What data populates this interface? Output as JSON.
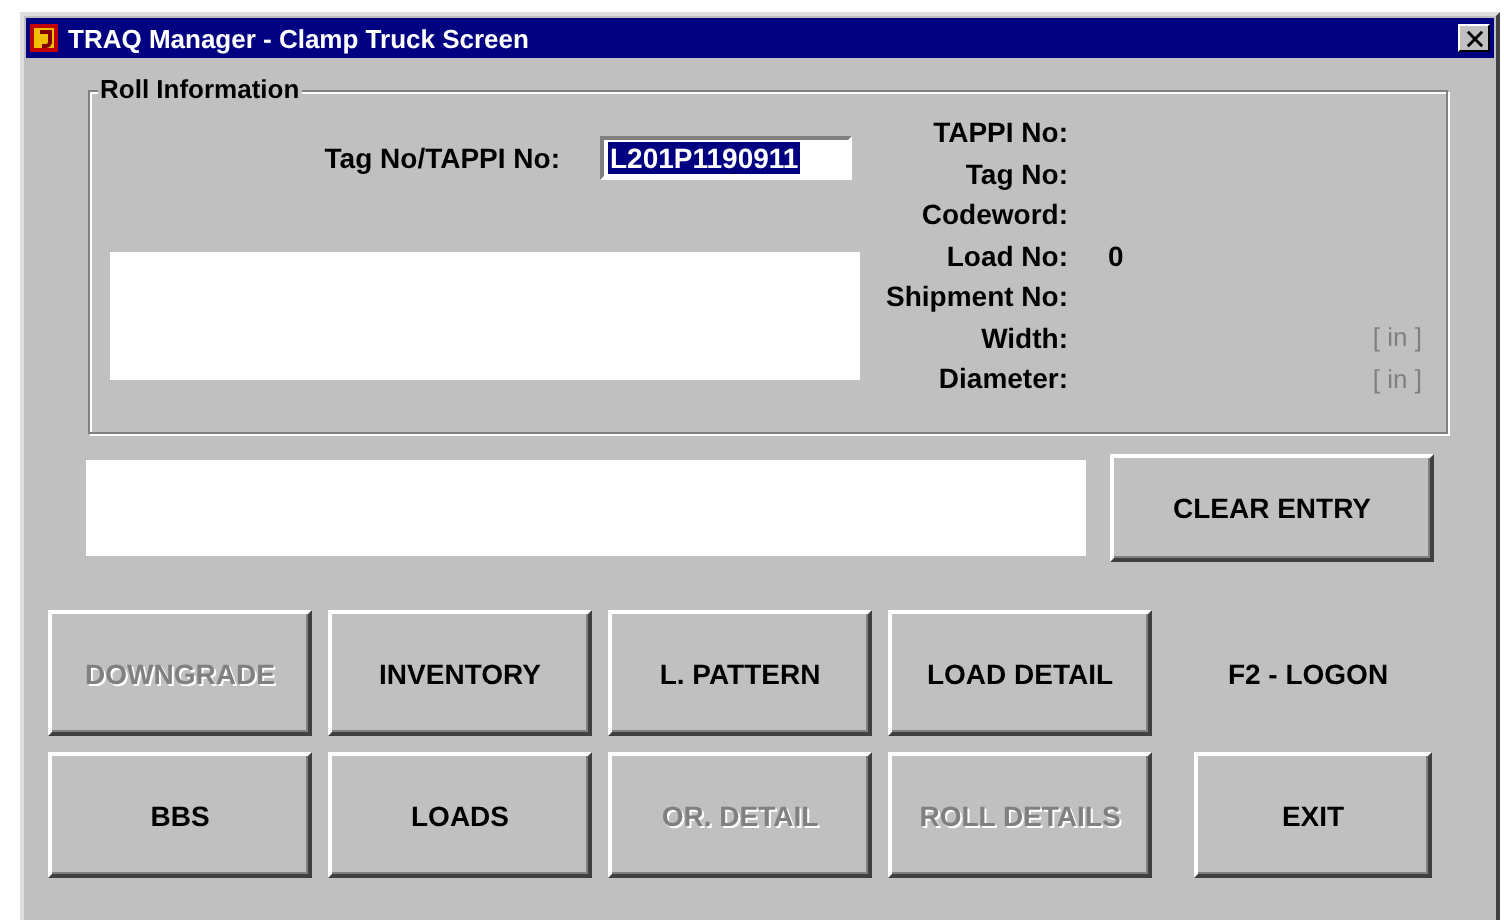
{
  "window": {
    "title": "TRAQ Manager - Clamp Truck Screen"
  },
  "roll_information": {
    "title": "Roll Information",
    "tag_field": {
      "label": "Tag No/TAPPI No:",
      "value": "L201P1190911",
      "selected": true
    },
    "details": [
      {
        "label": "TAPPI No:"
      },
      {
        "label": "Tag No:"
      },
      {
        "label": "Codeword:"
      },
      {
        "label": "Load No:",
        "value": "0"
      },
      {
        "label": "Shipment No:"
      },
      {
        "label": "Width:",
        "unit": "[ in ]"
      },
      {
        "label": "Diameter:",
        "unit": "[ in ]"
      }
    ]
  },
  "clear_entry_button": {
    "label": "CLEAR ENTRY",
    "disabled": false
  },
  "buttons": [
    {
      "kind": "button",
      "label": "DOWNGRADE",
      "disabled": true
    },
    {
      "kind": "button",
      "label": "INVENTORY",
      "disabled": false
    },
    {
      "kind": "button",
      "label": "L. PATTERN",
      "disabled": false
    },
    {
      "kind": "button",
      "label": "LOAD DETAIL",
      "disabled": false
    },
    {
      "kind": "text",
      "label": "F2 - LOGON"
    },
    {
      "kind": "button",
      "label": "BBS",
      "disabled": false
    },
    {
      "kind": "button",
      "label": "LOADS",
      "disabled": false
    },
    {
      "kind": "button",
      "label": "OR. DETAIL",
      "disabled": true
    },
    {
      "kind": "button",
      "label": "ROLL DETAILS",
      "disabled": true
    },
    {
      "kind": "button",
      "label": "EXIT",
      "disabled": false
    }
  ]
}
